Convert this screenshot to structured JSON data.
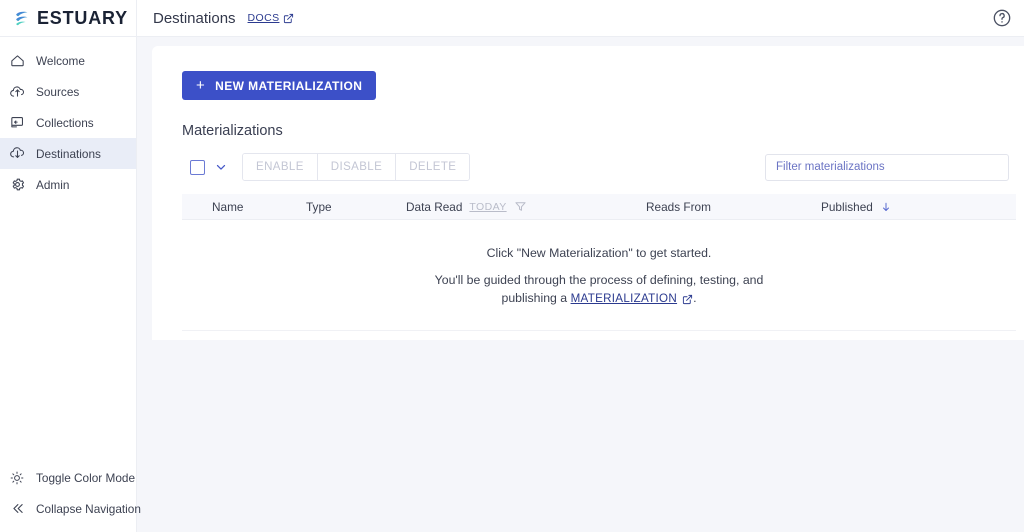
{
  "brand": {
    "name": "ESTUARY",
    "logo_icon": "estuary-logo-icon",
    "gradient_from": "#3e63e0",
    "gradient_to": "#4fd0c0"
  },
  "topbar": {
    "page_title": "Destinations",
    "docs_label": "DOCS",
    "docs_external_icon": "external-link-icon",
    "help_icon": "help-circle-icon"
  },
  "sidebar": {
    "items": [
      {
        "label": "Welcome",
        "icon": "home-icon",
        "active": false
      },
      {
        "label": "Sources",
        "icon": "cloud-upload-icon",
        "active": false
      },
      {
        "label": "Collections",
        "icon": "collections-icon",
        "active": false
      },
      {
        "label": "Destinations",
        "icon": "cloud-download-icon",
        "active": true
      },
      {
        "label": "Admin",
        "icon": "gear-icon",
        "active": false
      }
    ],
    "bottom_items": [
      {
        "label": "Toggle Color Mode",
        "icon": "sun-icon"
      },
      {
        "label": "Collapse Navigation",
        "icon": "chevron-double-left-icon"
      }
    ]
  },
  "main": {
    "new_button": {
      "label": "NEW MATERIALIZATION",
      "plus_icon": "plus-icon",
      "color": "#3c50c8"
    },
    "section_title": "Materializations",
    "toolbar": {
      "select_all_checkbox": "select-all-checkbox",
      "dropdown_icon": "chevron-down-icon",
      "enable_label": "ENABLE",
      "disable_label": "DISABLE",
      "delete_label": "DELETE",
      "filter_placeholder": "Filter materializations",
      "filter_value": ""
    },
    "table": {
      "columns": [
        {
          "key": "name",
          "label": "Name"
        },
        {
          "key": "type",
          "label": "Type"
        },
        {
          "key": "data_read",
          "label": "Data Read",
          "chip": "TODAY",
          "filter_icon": "funnel-icon"
        },
        {
          "key": "reads_from",
          "label": "Reads From"
        },
        {
          "key": "published",
          "label": "Published",
          "sort_icon": "arrow-down-icon",
          "sort": "desc"
        }
      ],
      "rows": []
    },
    "empty_state": {
      "line1": "Click \"New Materialization\" to get started.",
      "line2_prefix": "You'll be guided through the process of defining, testing, and",
      "line2_middle": "publishing a",
      "link_label": "MATERIALIZATION",
      "link_external_icon": "external-link-icon",
      "line2_suffix": "."
    }
  }
}
